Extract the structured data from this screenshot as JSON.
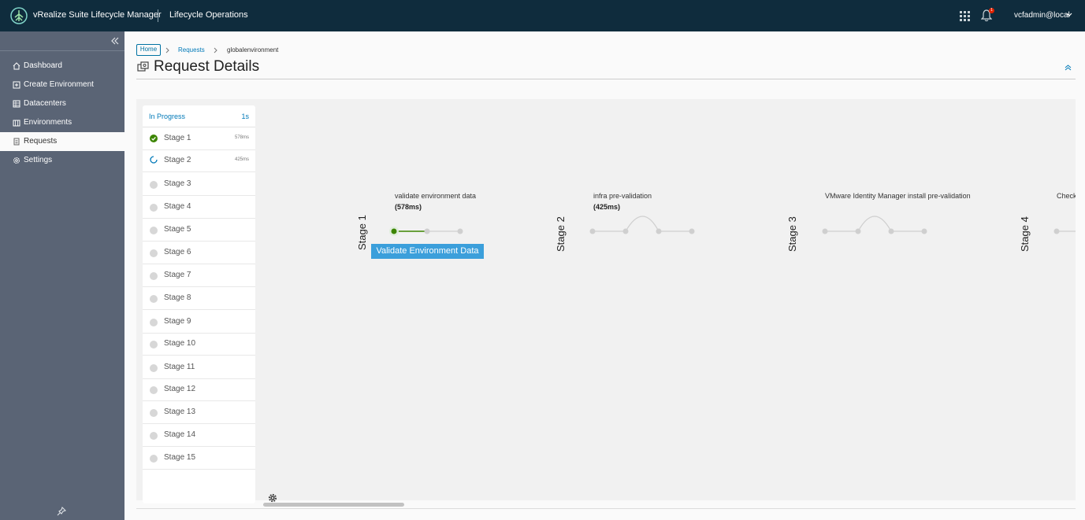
{
  "header": {
    "app_title": "vRealize Suite Lifecycle Manager",
    "section_title": "Lifecycle Operations",
    "notification_count": "1",
    "user": "vcfadmin@local",
    "bg_color": "#0f2c3d"
  },
  "sidebar": {
    "items": [
      {
        "label": "Dashboard",
        "icon": "home-icon"
      },
      {
        "label": "Create Environment",
        "icon": "create-environment-icon"
      },
      {
        "label": "Datacenters",
        "icon": "datacenter-icon"
      },
      {
        "label": "Environments",
        "icon": "environment-icon"
      },
      {
        "label": "Requests",
        "icon": "requests-icon",
        "active": true
      },
      {
        "label": "Settings",
        "icon": "settings-icon"
      }
    ]
  },
  "breadcrumb": {
    "home": "Home",
    "requests": "Requests",
    "current": "globalenvironment"
  },
  "page": {
    "title": "Request Details"
  },
  "stage_list": {
    "status": "In Progress",
    "elapsed": "1s",
    "stages": [
      {
        "name": "Stage 1",
        "duration": "578ms",
        "state": "done"
      },
      {
        "name": "Stage 2",
        "duration": "425ms",
        "state": "running"
      },
      {
        "name": "Stage 3",
        "state": "pending"
      },
      {
        "name": "Stage 4",
        "state": "pending"
      },
      {
        "name": "Stage 5",
        "state": "pending"
      },
      {
        "name": "Stage 6",
        "state": "pending"
      },
      {
        "name": "Stage 7",
        "state": "pending"
      },
      {
        "name": "Stage 8",
        "state": "pending"
      },
      {
        "name": "Stage 9",
        "state": "pending"
      },
      {
        "name": "Stage 10",
        "state": "pending"
      },
      {
        "name": "Stage 11",
        "state": "pending"
      },
      {
        "name": "Stage 12",
        "state": "pending"
      },
      {
        "name": "Stage 13",
        "state": "pending"
      },
      {
        "name": "Stage 14",
        "state": "pending"
      },
      {
        "name": "Stage 15",
        "state": "pending"
      }
    ]
  },
  "flow": {
    "stages": [
      {
        "label": "Stage 1",
        "task": "validate environment data",
        "duration": "(578ms)"
      },
      {
        "label": "Stage 2",
        "task": "infra pre-validation",
        "duration": "(425ms)"
      },
      {
        "label": "Stage 3",
        "task": "VMware Identity Manager install pre-validation",
        "duration": ""
      },
      {
        "label": "Stage 4",
        "task": "Check",
        "duration": ""
      }
    ],
    "tooltip": "Validate Environment Data"
  },
  "colors": {
    "accent": "#0079b8",
    "success": "#3c8500",
    "tooltip": "#3b9fdb",
    "sidebar": "#5a6475"
  }
}
